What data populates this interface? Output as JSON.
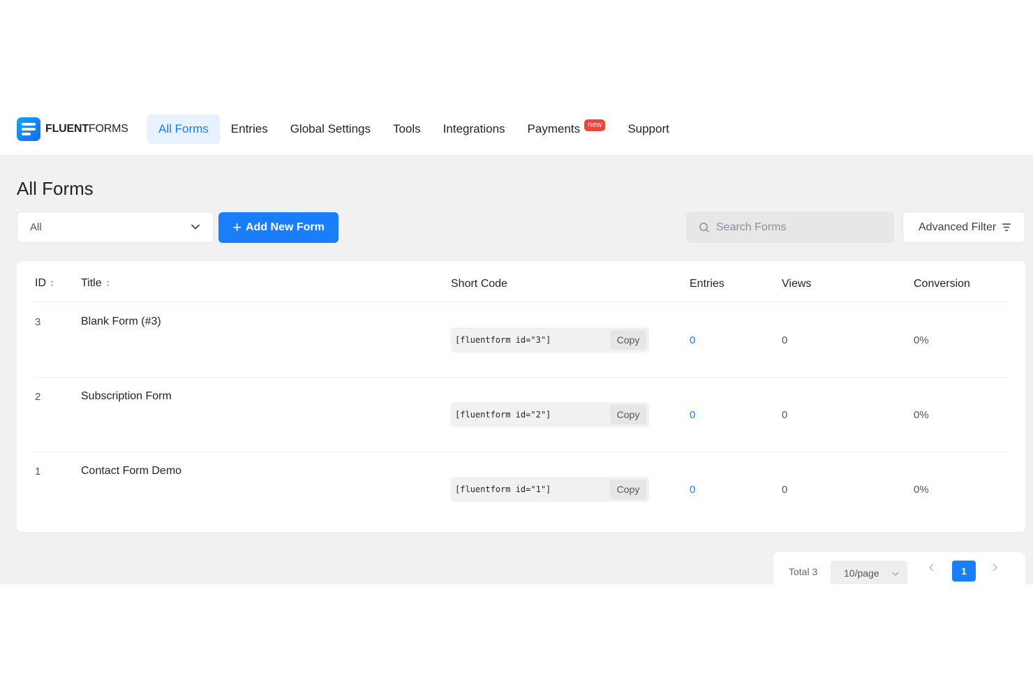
{
  "brand": {
    "bold": "FLUENT",
    "light": "FORMS"
  },
  "nav": [
    {
      "label": "All Forms",
      "active": true
    },
    {
      "label": "Entries"
    },
    {
      "label": "Global Settings"
    },
    {
      "label": "Tools"
    },
    {
      "label": "Integrations"
    },
    {
      "label": "Payments",
      "badge": "new"
    },
    {
      "label": "Support"
    }
  ],
  "page": {
    "title": "All Forms"
  },
  "toolbar": {
    "filter_value": "All",
    "add_button": "Add New Form",
    "search_placeholder": "Search Forms",
    "advanced_filter": "Advanced Filter"
  },
  "table": {
    "columns": [
      "ID",
      "Title",
      "Short Code",
      "Entries",
      "Views",
      "Conversion"
    ],
    "copy_label": "Copy",
    "rows": [
      {
        "id": "3",
        "title": "Blank Form (#3)",
        "shortcode": "[fluentform id=\"3\"]",
        "entries": "0",
        "views": "0",
        "conversion": "0%"
      },
      {
        "id": "2",
        "title": "Subscription Form",
        "shortcode": "[fluentform id=\"2\"]",
        "entries": "0",
        "views": "0",
        "conversion": "0%"
      },
      {
        "id": "1",
        "title": "Contact Form Demo",
        "shortcode": "[fluentform id=\"1\"]",
        "entries": "0",
        "views": "0",
        "conversion": "0%"
      }
    ]
  },
  "pagination": {
    "total": "Total 3",
    "page_size": "10/page",
    "current_page": "1"
  },
  "colors": {
    "accent": "#1a7efb",
    "badge": "#f04438",
    "page_bg": "#f1f1f1"
  }
}
